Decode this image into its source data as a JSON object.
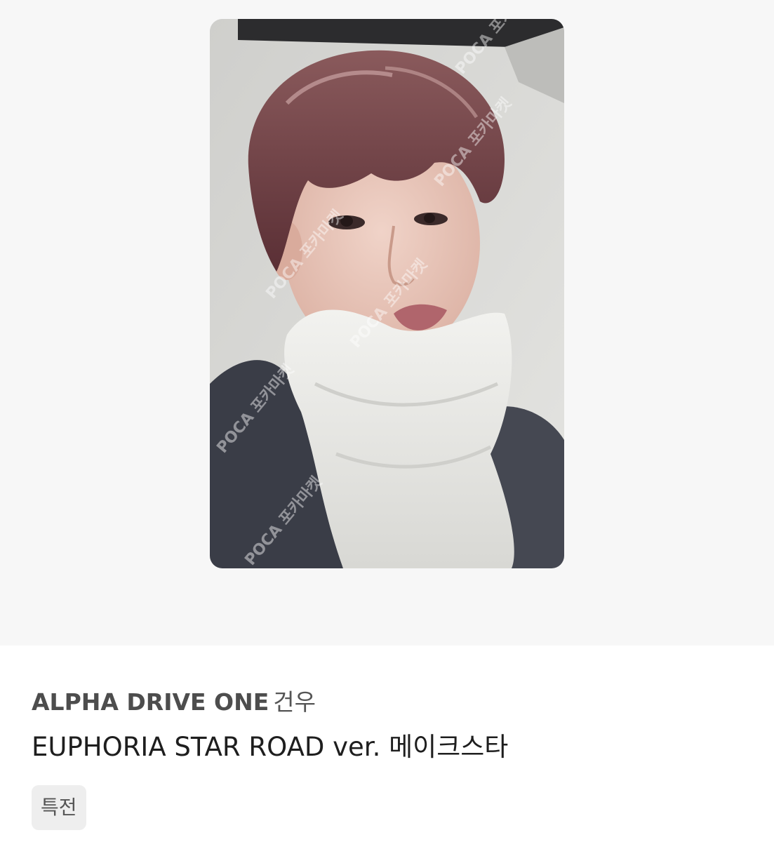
{
  "product": {
    "image_alt": "photocard",
    "watermark": "POCA 포카마켓",
    "group": "ALPHA DRIVE ONE",
    "member": "건우",
    "album": "EUPHORIA STAR ROAD ver. 메이크스타",
    "tags": [
      "특전"
    ]
  },
  "colors": {
    "image_background": "#f7f7f7",
    "tag_background": "#eeeeee",
    "text_primary": "#1e1e1e",
    "text_secondary": "#4a4a4a"
  }
}
